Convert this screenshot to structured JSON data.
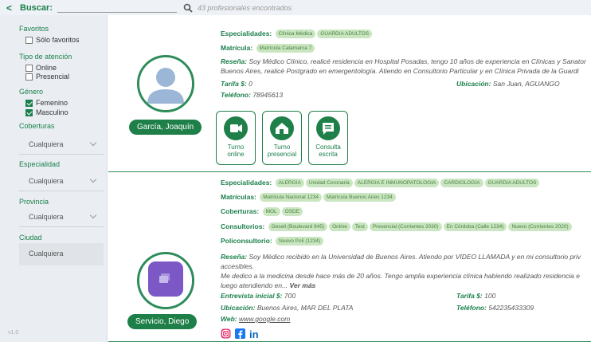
{
  "topbar": {
    "back": "<",
    "label": "Buscar:",
    "search_value": "",
    "count": "43 profesionales encontrados"
  },
  "sidebar": {
    "favoritos": "Favoritos",
    "solo_favoritos": "Sólo favoritos",
    "tipo": "Tipo de atención",
    "online": "Online",
    "presencial": "Presencial",
    "genero": "Género",
    "femenino": "Femenino",
    "masculino": "Masculino",
    "coberturas": "Coberturas",
    "coberturas_value": "Cualquiera",
    "especialidad": "Especialidad",
    "especialidad_value": "Cualquiera",
    "provincia": "Provincia",
    "provincia_value": "Cualquiera",
    "ciudad": "Ciudad",
    "ciudad_value": "Cualquiera",
    "version": "v1.0"
  },
  "card1": {
    "name": "García, Joaquín",
    "especialidades_label": "Especialidades:",
    "especialidades": [
      "Clínica Médica",
      "GUARDIA ADULTOS"
    ],
    "matricula_label": "Matrícula:",
    "matricula": "Matrícula Catamarca 7",
    "resena_label": "Reseña:",
    "resena_1": "Soy Médico Clínico, realicé residencia en Hospital Posadas, tengo 10 años de experiencia en Clínicas y Sanator",
    "resena_2": "Buenos Aires, realicé Postgrado en emergentología. Atiendo en Consultorio Particular y en Clínica Privada de la Guardi",
    "tarifa_label": "Tarifa $:",
    "tarifa": "0",
    "ubicacion_label": "Ubicación:",
    "ubicacion": "San Juan, AGUANGO",
    "telefono_label": "Teléfono:",
    "telefono": "78945613",
    "btn_online_1": "Turno",
    "btn_online_2": "online",
    "btn_presencial_1": "Turno",
    "btn_presencial_2": "presencial",
    "btn_consulta_1": "Consulta",
    "btn_consulta_2": "escrita"
  },
  "card2": {
    "name": "Servicio, Diego",
    "especialidades_label": "Especialidades:",
    "especialidades": [
      "ALERGIA",
      "Unidad Coronaria",
      "ALERGIA E INMUNOPATOLOGIA",
      "CARDIOLOGIA",
      "GUARDIA ADULTOS"
    ],
    "matriculas_label": "Matrículas:",
    "matriculas": [
      "Matricula Nacional 1234",
      "Matricula Buenos Aires 1234"
    ],
    "coberturas_label": "Coberturas:",
    "coberturas": [
      "MOL",
      "OSDE"
    ],
    "consultorios_label": "Consultorios:",
    "consultorios": [
      "Gesell (Boulevard 845)",
      "Online",
      "Test",
      "Presencial (Corrientes 2030)",
      "En Córdoba (Calle 1234)",
      "Nuevo (Corrientes 2020)"
    ],
    "policonsultorio_label": "Policonsultorio:",
    "policonsultorio": [
      "Nuevo Poli (1234)"
    ],
    "resena_label": "Reseña:",
    "resena_1": "Soy Médico recibido en la Universidad de Buenos Aires. Atiendo por VIDEO LLAMADA y en mi consultorio priv",
    "resena_2": "accesibles.",
    "resena_3": "Me dedico a la medicina desde hace más de 20 años. Tengo amplia experiencia clínica habiendo realizado residencia e",
    "resena_4": "luego atendiendo en...",
    "ver_mas": "Ver más",
    "entrevista_label": "Entrevista inicial $:",
    "entrevista": "700",
    "tarifa_label": "Tarifa $:",
    "tarifa": "100",
    "ubicacion_label": "Ubicación:",
    "ubicacion": "Buenos Aires, MAR DEL PLATA",
    "telefono_label": "Teléfono:",
    "telefono": "542235433309",
    "web_label": "Web:",
    "web": "www.google.com",
    "social_in": "in"
  }
}
